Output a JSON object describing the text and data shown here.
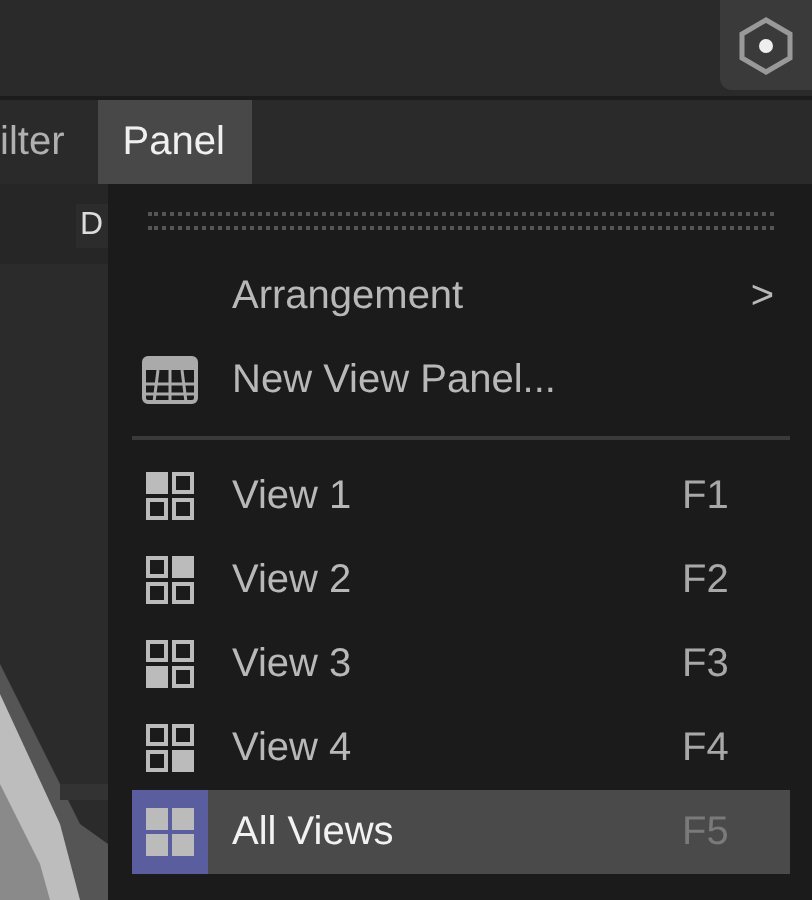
{
  "menu_bar": [
    {
      "label": "ilter",
      "selected": false
    },
    {
      "label": "Panel",
      "selected": true
    }
  ],
  "viewport": {
    "kind": "picture",
    "label": "D"
  },
  "menu": {
    "top_items": [
      {
        "kind": "submenu",
        "label": "Arrangement",
        "arrow": ">"
      },
      {
        "kind": "command",
        "label": "New View Panel..."
      }
    ],
    "view_items": [
      {
        "kind": "view",
        "label": "View 1",
        "shortcut": "F1",
        "selected": false
      },
      {
        "kind": "view",
        "label": "View 2",
        "shortcut": "F2",
        "selected": false
      },
      {
        "kind": "view",
        "label": "View 3",
        "shortcut": "F3",
        "selected": false
      },
      {
        "kind": "view",
        "label": "View 4",
        "shortcut": "F4",
        "selected": false
      },
      {
        "kind": "all",
        "label": "All Views",
        "shortcut": "F5",
        "selected": true
      }
    ]
  }
}
